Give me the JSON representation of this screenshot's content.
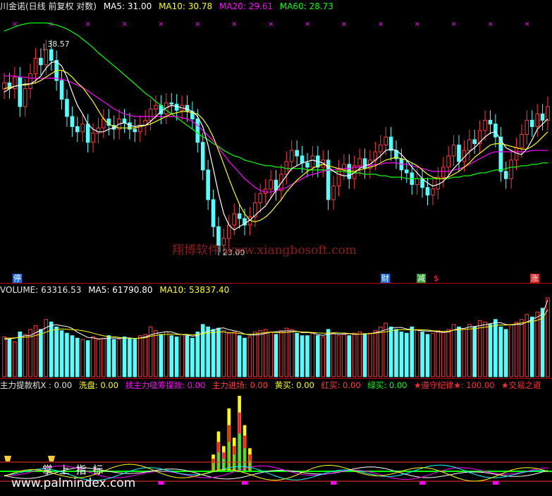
{
  "price_header": {
    "title": "川金诺(日线 前复权 对数)",
    "ma5": "MA5: 31.00",
    "ma10": "MA10: 30.78",
    "ma20": "MA20: 29.61",
    "ma60": "MA60: 28.73"
  },
  "volume_header": {
    "volume": "VOLUME: 63316.53",
    "ma5": "MA5: 61790.80",
    "ma10": "MA10: 53837.40"
  },
  "indicator_header": {
    "item1": "主力提款机X : 0.00",
    "item2": "洗盘: 0.00",
    "item3": "找主力吸筹提款: 0.00",
    "item4": "主力进场: 0.00",
    "item5": "黄买: 0.00",
    "item6": "红买: 0.00",
    "item7": "绿买: 0.00",
    "item8": "★遵守纪律★: 100.00",
    "item9": "★交易之道"
  },
  "flags": {
    "stop": "停",
    "finance": "财",
    "reduce": "减",
    "dollar": "$",
    "rise": "涨"
  },
  "watermark": "翔博软件 www.xiangbosoft.com",
  "footer": {
    "palm_title": "掌 上 指 标",
    "palm_url": "www.palmindex.com"
  },
  "colors": {
    "up": "#ff3b3b",
    "down": "#54ffff",
    "ma5": "#ffffff",
    "ma10": "#ffff00",
    "ma20": "#ff00ff",
    "ma60": "#00ff00"
  },
  "chart_data": [
    {
      "type": "candlestick",
      "title": "川金诺(日线 前复权 对数)",
      "annotations": [
        {
          "label": "38.57",
          "value": 38.57
        },
        {
          "label": "23.00",
          "value": 23.0
        }
      ],
      "ylim": [
        21.5,
        41.5
      ],
      "scale": "log",
      "close": [
        35.0,
        34.5,
        35.5,
        33.0,
        34.5,
        35.8,
        37.2,
        36.6,
        38.0,
        37.0,
        35.2,
        33.6,
        32.2,
        31.4,
        31.0,
        31.6,
        30.2,
        30.9,
        31.3,
        32.0,
        31.5,
        31.2,
        32.0,
        31.7,
        31.2,
        31.0,
        31.5,
        31.9,
        32.8,
        33.1,
        32.4,
        33.3,
        33.2,
        32.7,
        33.1,
        32.6,
        32.0,
        30.2,
        28.2,
        26.2,
        24.5,
        23.4,
        23.8,
        24.6,
        25.3,
        25.0,
        24.6,
        25.1,
        26.0,
        26.6,
        26.9,
        27.5,
        26.8,
        27.9,
        28.8,
        29.6,
        29.2,
        28.7,
        28.4,
        29.2,
        28.4,
        28.9,
        26.2,
        27.1,
        28.2,
        28.6,
        27.6,
        28.5,
        29.0,
        28.3,
        28.9,
        29.5,
        30.0,
        30.6,
        29.6,
        29.0,
        28.2,
        28.0,
        27.2,
        27.6,
        27.0,
        26.5,
        26.9,
        27.7,
        28.4,
        29.2,
        30.0,
        28.8,
        29.6,
        30.4,
        30.1,
        31.1,
        31.9,
        31.6,
        30.6,
        28.1,
        27.6,
        28.9,
        29.8,
        30.8,
        31.9,
        31.4,
        32.4,
        31.9,
        33.0
      ],
      "ma5": [
        34.2,
        34.5,
        34.7,
        34.8,
        34.9,
        34.9,
        35.2,
        35.6,
        36.3,
        36.8,
        36.9,
        36.5,
        35.5,
        34.2,
        33.1,
        32.4,
        31.6,
        31.2,
        31.0,
        31.0,
        31.2,
        31.3,
        31.6,
        31.7,
        31.5,
        31.4,
        31.5,
        31.5,
        31.8,
        32.2,
        32.6,
        32.9,
        33.1,
        33.0,
        32.9,
        32.8,
        32.6,
        32.2,
        31.4,
        30.0,
        28.3,
        26.6,
        25.3,
        24.6,
        24.3,
        24.5,
        24.7,
        24.9,
        25.2,
        25.5,
        25.8,
        26.3,
        26.8,
        27.3,
        27.8,
        28.3,
        28.5,
        28.7,
        28.8,
        28.9,
        28.8,
        28.7,
        28.4,
        28.1,
        27.9,
        27.8,
        27.8,
        28.0,
        28.3,
        28.5,
        28.6,
        28.9,
        29.2,
        29.6,
        29.7,
        29.6,
        29.3,
        28.9,
        28.4,
        28.0,
        27.6,
        27.3,
        27.1,
        27.2,
        27.4,
        27.8,
        28.3,
        28.7,
        29.1,
        29.5,
        29.8,
        30.2,
        30.6,
        30.9,
        31.0,
        30.4,
        29.8,
        29.6,
        29.4,
        29.3,
        29.7,
        30.4,
        31.2,
        31.6,
        32.0
      ],
      "ma10": [
        34.5,
        34.6,
        34.7,
        34.8,
        34.8,
        34.9,
        35.0,
        35.2,
        35.5,
        35.8,
        36.1,
        36.1,
        35.9,
        35.5,
        35.0,
        34.6,
        34.0,
        33.4,
        32.7,
        32.0,
        31.6,
        31.4,
        31.3,
        31.3,
        31.3,
        31.3,
        31.4,
        31.5,
        31.6,
        31.8,
        32.0,
        32.2,
        32.4,
        32.5,
        32.6,
        32.6,
        32.5,
        32.4,
        32.0,
        31.4,
        30.6,
        29.6,
        28.6,
        27.6,
        26.7,
        25.9,
        25.3,
        24.9,
        24.8,
        24.9,
        25.1,
        25.4,
        25.8,
        26.2,
        26.7,
        27.1,
        27.5,
        27.8,
        28.1,
        28.3,
        28.5,
        28.6,
        28.5,
        28.4,
        28.3,
        28.2,
        28.1,
        28.1,
        28.2,
        28.3,
        28.4,
        28.5,
        28.7,
        28.9,
        29.0,
        29.1,
        29.0,
        28.9,
        28.7,
        28.5,
        28.2,
        27.9,
        27.7,
        27.6,
        27.6,
        27.7,
        27.9,
        28.1,
        28.4,
        28.7,
        29.1,
        29.4,
        29.7,
        30.0,
        30.1,
        30.1,
        30.0,
        29.9,
        29.8,
        29.7,
        29.7,
        29.9,
        30.2,
        30.6,
        31.0
      ],
      "ma20": [
        35.6,
        35.6,
        35.6,
        35.5,
        35.5,
        35.4,
        35.4,
        35.4,
        35.4,
        35.4,
        35.4,
        35.3,
        35.2,
        35.0,
        34.8,
        34.6,
        34.3,
        34.0,
        33.7,
        33.4,
        33.1,
        32.8,
        32.6,
        32.4,
        32.3,
        32.2,
        32.2,
        32.2,
        32.2,
        32.2,
        32.2,
        32.2,
        32.2,
        32.2,
        32.1,
        32.0,
        31.8,
        31.5,
        31.1,
        30.7,
        30.3,
        29.8,
        29.3,
        28.8,
        28.4,
        28.0,
        27.6,
        27.3,
        27.0,
        26.8,
        26.7,
        26.7,
        26.8,
        26.9,
        27.0,
        27.2,
        27.4,
        27.6,
        27.8,
        27.9,
        28.0,
        28.1,
        28.2,
        28.2,
        28.3,
        28.3,
        28.3,
        28.4,
        28.4,
        28.5,
        28.5,
        28.6,
        28.6,
        28.7,
        28.7,
        28.7,
        28.6,
        28.6,
        28.5,
        28.4,
        28.3,
        28.2,
        28.1,
        28.1,
        28.1,
        28.1,
        28.2,
        28.3,
        28.4,
        28.6,
        28.8,
        29.0,
        29.2,
        29.4,
        29.5,
        29.5,
        29.5,
        29.5,
        29.5,
        29.5,
        29.5,
        29.6,
        29.6,
        29.6,
        29.6
      ],
      "ma60": [
        39.8,
        40.0,
        40.2,
        40.4,
        40.5,
        40.6,
        40.6,
        40.6,
        40.6,
        40.5,
        40.4,
        40.2,
        40.0,
        39.7,
        39.4,
        39.0,
        38.6,
        38.2,
        37.7,
        37.3,
        36.9,
        36.5,
        36.1,
        35.7,
        35.3,
        34.9,
        34.5,
        34.1,
        33.8,
        33.4,
        33.1,
        32.7,
        32.4,
        32.1,
        31.8,
        31.5,
        31.2,
        30.9,
        30.6,
        30.4,
        30.1,
        29.9,
        29.6,
        29.4,
        29.2,
        29.1,
        28.9,
        28.8,
        28.7,
        28.6,
        28.5,
        28.5,
        28.4,
        28.4,
        28.3,
        28.3,
        28.3,
        28.3,
        28.2,
        28.2,
        28.2,
        28.2,
        28.2,
        28.1,
        28.1,
        28.1,
        28.0,
        28.0,
        28.0,
        27.9,
        27.9,
        27.9,
        27.8,
        27.8,
        27.7,
        27.7,
        27.7,
        27.6,
        27.6,
        27.6,
        27.6,
        27.6,
        27.6,
        27.6,
        27.6,
        27.6,
        27.7,
        27.7,
        27.8,
        27.8,
        27.9,
        28.0,
        28.0,
        28.1,
        28.2,
        28.2,
        28.3,
        28.4,
        28.4,
        28.5,
        28.5,
        28.6,
        28.6,
        28.7,
        28.7
      ]
    },
    {
      "type": "bar",
      "title": "VOLUME",
      "series": [
        {
          "name": "VOLUME",
          "values": [
            32000,
            30000,
            28000,
            36000,
            34000,
            38000,
            41000,
            38000,
            46000,
            44000,
            40000,
            37000,
            35000,
            33000,
            31000,
            30000,
            29000,
            32000,
            30000,
            31000,
            33000,
            30000,
            30000,
            32000,
            31000,
            30000,
            33000,
            34000,
            40000,
            37000,
            34000,
            36000,
            33000,
            32000,
            34000,
            33000,
            31000,
            36000,
            42000,
            40000,
            38000,
            39000,
            37000,
            35000,
            36000,
            33000,
            31000,
            32000,
            36000,
            37000,
            38000,
            36000,
            34000,
            37000,
            39000,
            38000,
            35000,
            33000,
            33000,
            35000,
            33000,
            32000,
            38000,
            35000,
            33000,
            34000,
            33000,
            35000,
            36000,
            34000,
            35000,
            37000,
            40000,
            43000,
            40000,
            38000,
            36000,
            35000,
            40000,
            38000,
            36000,
            34000,
            35000,
            37000,
            36000,
            38000,
            42000,
            40000,
            38000,
            42000,
            40000,
            45000,
            44000,
            42000,
            46000,
            40000,
            38000,
            42000,
            44000,
            46000,
            50000,
            48000,
            52000,
            55000,
            63316
          ]
        },
        {
          "name": "MA5",
          "values": [
            30000,
            30500,
            31000,
            32000,
            33000,
            33200,
            35400,
            37400,
            39400,
            41400,
            41800,
            41000,
            40400,
            38800,
            35800,
            33600,
            31600,
            31200,
            30400,
            30600,
            31000,
            31200,
            30800,
            31200,
            31200,
            30600,
            31200,
            32000,
            33600,
            34800,
            35600,
            36200,
            36000,
            34600,
            33800,
            33600,
            32600,
            33200,
            35200,
            36400,
            37400,
            39000,
            39200,
            37800,
            37000,
            36000,
            34400,
            33400,
            33600,
            33800,
            34800,
            35800,
            36200,
            36400,
            36800,
            36800,
            36600,
            35400,
            35600,
            35200,
            33800,
            33200,
            34200,
            34600,
            34200,
            34400,
            34600,
            34000,
            34200,
            34600,
            34600,
            35400,
            36400,
            37800,
            39000,
            39600,
            39600,
            38400,
            37800,
            37400,
            37000,
            36600,
            36600,
            36000,
            35600,
            36000,
            37600,
            38600,
            38800,
            40000,
            40400,
            41000,
            41800,
            42600,
            43400,
            43400,
            42000,
            41600,
            42000,
            42000,
            44000,
            46000,
            48000,
            50200,
            61790
          ]
        },
        {
          "name": "MA10",
          "values": [
            31000,
            31000,
            31200,
            31500,
            31800,
            32000,
            33200,
            34200,
            35800,
            37400,
            37800,
            38400,
            38200,
            37800,
            37600,
            37000,
            36200,
            35000,
            33800,
            32900,
            32200,
            32200,
            31600,
            31000,
            31000,
            30800,
            31000,
            31400,
            32600,
            33200,
            33800,
            34000,
            34200,
            34000,
            34000,
            34000,
            33600,
            34000,
            34600,
            35200,
            35400,
            36100,
            36000,
            35400,
            35200,
            34800,
            34200,
            34000,
            34400,
            35000,
            35400,
            35800,
            35600,
            35300,
            35600,
            36000,
            36400,
            35900,
            35900,
            35600,
            35200,
            35000,
            35000,
            35400,
            35200,
            35100,
            34800,
            34400,
            34200,
            34400,
            34600,
            35000,
            35500,
            36100,
            36900,
            37500,
            37900,
            37800,
            37600,
            37700,
            37700,
            37500,
            37000,
            36600,
            36400,
            36600,
            37400,
            37800,
            38000,
            38400,
            38600,
            39200,
            39800,
            40400,
            41200,
            41600,
            41500,
            41800,
            42500,
            43200,
            43800,
            44400,
            45400,
            47000,
            53837
          ]
        }
      ]
    },
    {
      "type": "bar",
      "title": "主力提款机X",
      "series": [
        {
          "name": "主力提款机X",
          "values": [
            0,
            0,
            0,
            0,
            0,
            0,
            0,
            0,
            0,
            0,
            0,
            0,
            0,
            0,
            0,
            0,
            0,
            0,
            0,
            0,
            0,
            0,
            0,
            0,
            0,
            0,
            0,
            0,
            0,
            0,
            0,
            0,
            0,
            0,
            0,
            0,
            0,
            0,
            0,
            0,
            0,
            0,
            0,
            0,
            0,
            0,
            0,
            0,
            0,
            0,
            0,
            0,
            0,
            0,
            0,
            0,
            0,
            0,
            0,
            0,
            0,
            0,
            0,
            0,
            0,
            0,
            0,
            0,
            0,
            0,
            0,
            0,
            0,
            0,
            0,
            0,
            0,
            0,
            0,
            0,
            0,
            0,
            0,
            0,
            0,
            0,
            0,
            0,
            0,
            0,
            0,
            0,
            0,
            0,
            0,
            0,
            0,
            0,
            0,
            0,
            0,
            0,
            0,
            0,
            0
          ]
        },
        {
          "name": "洗盘",
          "values": [
            0,
            0,
            0,
            0,
            0,
            0,
            0,
            0,
            0,
            0,
            0,
            0,
            0,
            0,
            0,
            0,
            0,
            0,
            0,
            0,
            0,
            0,
            0,
            0,
            0,
            0,
            0,
            0,
            0,
            0,
            0,
            0,
            0,
            0,
            0,
            0,
            0,
            0,
            0,
            0,
            0,
            0,
            0,
            0,
            0,
            0,
            0,
            0,
            0,
            0,
            0,
            0,
            0,
            0,
            0,
            0,
            0,
            0,
            0,
            0,
            0,
            0,
            0,
            0,
            0,
            0,
            0,
            0,
            0,
            0,
            0,
            0,
            0,
            0,
            0,
            0,
            0,
            0,
            0,
            0,
            0,
            0,
            0,
            0,
            0,
            0,
            0,
            0,
            0,
            0,
            0,
            0,
            0,
            0,
            0,
            0,
            0,
            0,
            0,
            0,
            0,
            0,
            0,
            0,
            0
          ]
        }
      ],
      "bars_yellow": {
        "index": [
          28,
          29,
          30,
          31,
          32,
          33,
          34,
          35
        ],
        "values": [
          40,
          95,
          60,
          150,
          80,
          180,
          110,
          55
        ]
      },
      "bars_red": {
        "index": [
          28,
          29,
          30,
          31,
          32,
          33,
          34,
          35
        ],
        "values": [
          30,
          70,
          45,
          110,
          60,
          140,
          85,
          40
        ]
      },
      "bars_green": {
        "index": [
          28,
          29,
          30,
          31,
          32,
          33,
          34,
          35
        ],
        "values": [
          20,
          45,
          30,
          70,
          40,
          90,
          55,
          25
        ]
      },
      "ylim": [
        0,
        190
      ]
    }
  ]
}
